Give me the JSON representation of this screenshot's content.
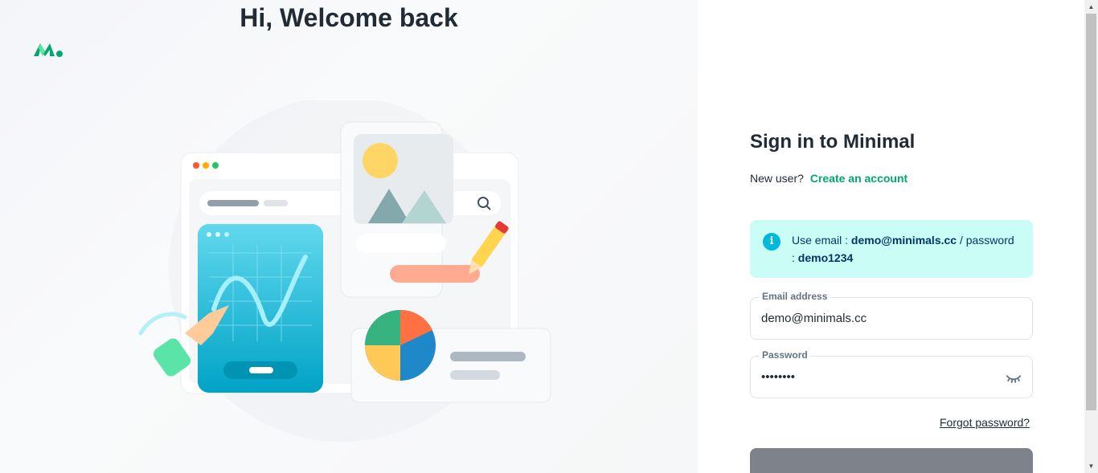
{
  "left": {
    "welcome": "Hi, Welcome back",
    "logo_icon": "minimal-logo"
  },
  "form": {
    "title": "Sign in to Minimal",
    "new_user_text": "New user?",
    "create_account_link": "Create an account",
    "alert": {
      "icon": "info-icon",
      "prefix": "Use email :",
      "email": "demo@minimals.cc",
      "separator": "/ password :",
      "password": "demo1234"
    },
    "email": {
      "label": "Email address",
      "value": "demo@minimals.cc"
    },
    "password": {
      "label": "Password",
      "value": "demo1234",
      "toggle_icon": "eye-closed-icon"
    },
    "forgot_link": "Forgot password?",
    "login_button_label": ""
  },
  "colors": {
    "primary": "#00a76f",
    "alert_bg": "#cafdf5",
    "alert_icon": "#00b8d9",
    "button_bg": "#7e828b"
  }
}
